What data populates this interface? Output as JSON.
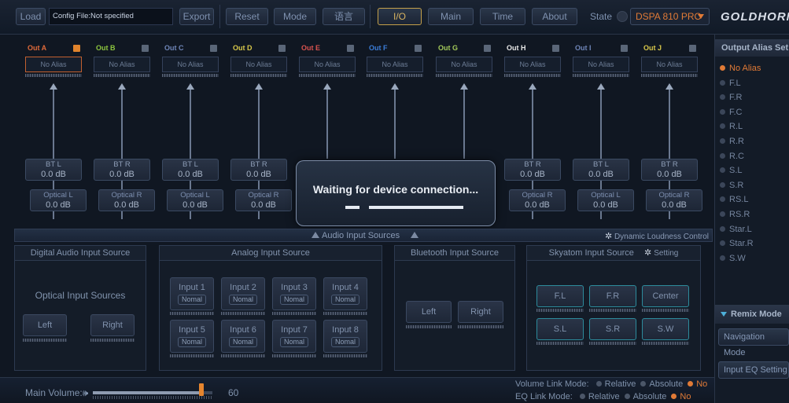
{
  "toolbar": {
    "load": "Load",
    "config_file": "Config File:Not specified",
    "export": "Export",
    "reset": "Reset",
    "mode": "Mode",
    "language": "语言",
    "tabs": [
      "I/O",
      "Main",
      "Time",
      "About"
    ],
    "active_tab": "I/O",
    "state_label": "State",
    "device": "DSPA 810 PRO",
    "brand": "GOLDHORN"
  },
  "outputs": [
    {
      "name": "Out A",
      "color": "#e06a3a",
      "alias": "No Alias",
      "checked": true,
      "src1": "BT L",
      "src1_val": "0.0 dB",
      "src2": "Optical L",
      "src2_val": "0.0 dB"
    },
    {
      "name": "Out B",
      "color": "#8dc63f",
      "alias": "No Alias",
      "checked": false,
      "src1": "BT R",
      "src1_val": "0.0 dB",
      "src2": "Optical R",
      "src2_val": "0.0 dB"
    },
    {
      "name": "Out C",
      "color": "#6f86b8",
      "alias": "No Alias",
      "checked": false,
      "src1": "BT L",
      "src1_val": "0.0 dB",
      "src2": "Optical L",
      "src2_val": "0.0 dB"
    },
    {
      "name": "Out D",
      "color": "#d9c84a",
      "alias": "No Alias",
      "checked": false,
      "src1": "BT R",
      "src1_val": "0.0 dB",
      "src2": "Optical R",
      "src2_val": "0.0 dB"
    },
    {
      "name": "Out E",
      "color": "#d9534f",
      "alias": "No Alias",
      "checked": false,
      "src1": "",
      "src1_val": "",
      "src2": "",
      "src2_val": ""
    },
    {
      "name": "Out F",
      "color": "#3b7dd8",
      "alias": "No Alias",
      "checked": false,
      "src1": "",
      "src1_val": "",
      "src2": "",
      "src2_val": ""
    },
    {
      "name": "Out G",
      "color": "#a3c95a",
      "alias": "No Alias",
      "checked": false,
      "src1": "",
      "src1_val": "",
      "src2": "",
      "src2_val": ""
    },
    {
      "name": "Out H",
      "color": "#e8e8e8",
      "alias": "No Alias",
      "checked": false,
      "src1": "BT R",
      "src1_val": "0.0 dB",
      "src2": "Optical R",
      "src2_val": "0.0 dB"
    },
    {
      "name": "Out I",
      "color": "#6f86b8",
      "alias": "No Alias",
      "checked": false,
      "src1": "BT L",
      "src1_val": "0.0 dB",
      "src2": "Optical L",
      "src2_val": "0.0 dB"
    },
    {
      "name": "Out J",
      "color": "#d9c84a",
      "alias": "No Alias",
      "checked": false,
      "src1": "BT R",
      "src1_val": "0.0 dB",
      "src2": "Optical R",
      "src2_val": "0.0 dB"
    }
  ],
  "modal": {
    "message": "Waiting for device connection..."
  },
  "input_strip": {
    "title": "Audio Input Sources",
    "dynamic_loudness": "Dynamic Loudness Control"
  },
  "panels": {
    "digital": {
      "title": "Digital Audio Input Source",
      "subtitle": "Optical Input Sources",
      "left": "Left",
      "right": "Right"
    },
    "analog": {
      "title": "Analog Input Source",
      "inputs": [
        {
          "name": "Input 1",
          "mode": "Nomal"
        },
        {
          "name": "Input 2",
          "mode": "Nomal"
        },
        {
          "name": "Input 3",
          "mode": "Nomal"
        },
        {
          "name": "Input 4",
          "mode": "Nomal"
        },
        {
          "name": "Input 5",
          "mode": "Nomal"
        },
        {
          "name": "Input 6",
          "mode": "Nomal"
        },
        {
          "name": "Input 7",
          "mode": "Nomal"
        },
        {
          "name": "Input 8",
          "mode": "Nomal"
        }
      ]
    },
    "bluetooth": {
      "title": "Bluetooth Input Source",
      "left": "Left",
      "right": "Right"
    },
    "skyatom": {
      "title": "Skyatom Input Source",
      "setting": "Setting",
      "channels": [
        "F.L",
        "F.R",
        "Center",
        "S.L",
        "S.R",
        "S.W"
      ]
    }
  },
  "sidebar": {
    "title": "Output Alias Set",
    "aliases": [
      "No Alias",
      "F.L",
      "F.R",
      "F.C",
      "R.L",
      "R.R",
      "R.C",
      "S.L",
      "S.R",
      "RS.L",
      "RS.R",
      "Star.L",
      "Star.R",
      "S.W"
    ],
    "selected": "No Alias",
    "remix_mode": "Remix Mode",
    "navigation_mode": "Navigation Mode",
    "input_eq": "Input EQ Setting"
  },
  "bottom": {
    "main_volume_label": "Main Volume:",
    "volume": 60,
    "volume_max": 66,
    "volume_link_label": "Volume Link Mode:",
    "eq_link_label": "EQ Link Mode:",
    "link_options": [
      "Relative",
      "Absolute",
      "No"
    ],
    "volume_link_selected": "No",
    "eq_link_selected": "No"
  }
}
